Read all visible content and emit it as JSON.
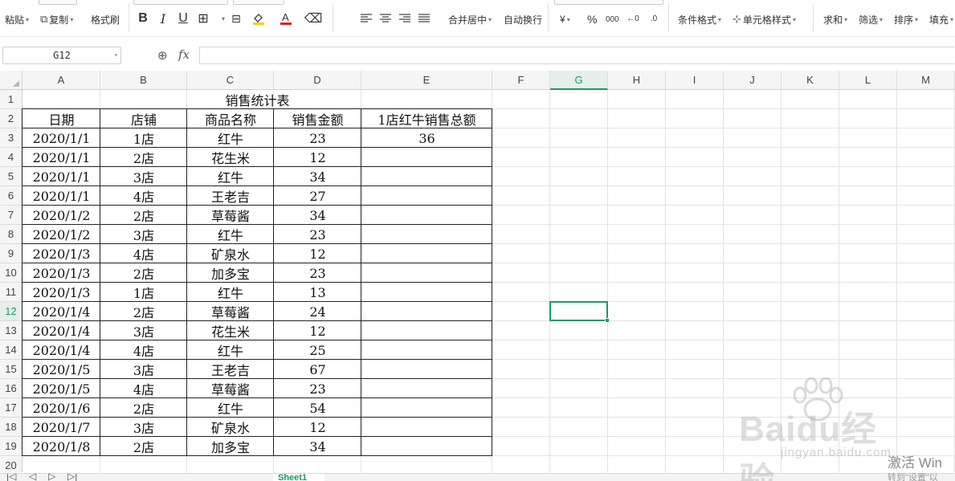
{
  "ribbon": {
    "paste": "粘贴",
    "copy": "复制",
    "format_painter": "格式刷",
    "merge_center": "合并居中",
    "wrap_text": "自动换行",
    "currency_symbol": "¥",
    "percent_symbol": "%",
    "thousands_symbol": "000",
    "conditional_format": "条件格式",
    "cell_style": "单元格样式",
    "sum": "求和",
    "filter": "筛选",
    "sort": "排序",
    "fill": "填充"
  },
  "formula_bar": {
    "name_box": "G12",
    "fx_label": "fx",
    "formula": ""
  },
  "columns": [
    "A",
    "B",
    "C",
    "D",
    "E",
    "F",
    "G",
    "H",
    "I",
    "J",
    "K",
    "L",
    "M"
  ],
  "active_column": "G",
  "row_numbers": [
    "1",
    "2",
    "3",
    "4",
    "5",
    "6",
    "7",
    "8",
    "9",
    "10",
    "11",
    "12",
    "13",
    "14",
    "15",
    "16",
    "17",
    "18",
    "19",
    "20"
  ],
  "active_row": "12",
  "sheet": {
    "title": "销售统计表",
    "headers": [
      "日期",
      "店铺",
      "商品名称",
      "销售金额",
      "1店红牛销售总额"
    ],
    "rows": [
      [
        "2020/1/1",
        "1店",
        "红牛",
        "23",
        "36"
      ],
      [
        "2020/1/1",
        "2店",
        "花生米",
        "12",
        ""
      ],
      [
        "2020/1/1",
        "3店",
        "红牛",
        "34",
        ""
      ],
      [
        "2020/1/1",
        "4店",
        "王老吉",
        "27",
        ""
      ],
      [
        "2020/1/2",
        "2店",
        "草莓酱",
        "34",
        ""
      ],
      [
        "2020/1/2",
        "3店",
        "红牛",
        "23",
        ""
      ],
      [
        "2020/1/3",
        "4店",
        "矿泉水",
        "12",
        ""
      ],
      [
        "2020/1/3",
        "2店",
        "加多宝",
        "23",
        ""
      ],
      [
        "2020/1/3",
        "1店",
        "红牛",
        "13",
        ""
      ],
      [
        "2020/1/4",
        "2店",
        "草莓酱",
        "24",
        ""
      ],
      [
        "2020/1/4",
        "3店",
        "花生米",
        "12",
        ""
      ],
      [
        "2020/1/4",
        "4店",
        "红牛",
        "25",
        ""
      ],
      [
        "2020/1/5",
        "3店",
        "王老吉",
        "67",
        ""
      ],
      [
        "2020/1/5",
        "4店",
        "草莓酱",
        "23",
        ""
      ],
      [
        "2020/1/6",
        "2店",
        "红牛",
        "54",
        ""
      ],
      [
        "2020/1/7",
        "3店",
        "矿泉水",
        "12",
        ""
      ],
      [
        "2020/1/8",
        "2店",
        "加多宝",
        "34",
        ""
      ]
    ]
  },
  "tabs": {
    "active": "Sheet1"
  },
  "watermark": {
    "brand": "Baidu经验",
    "url": "jingyan.baidu.com"
  },
  "os_notice": {
    "line1": "激活 Win",
    "line2": "转到\"设置\"以"
  },
  "colors": {
    "accent": "#1a9b5f",
    "grid": "#e3e3e3",
    "header_bg": "#f5f5f5"
  }
}
